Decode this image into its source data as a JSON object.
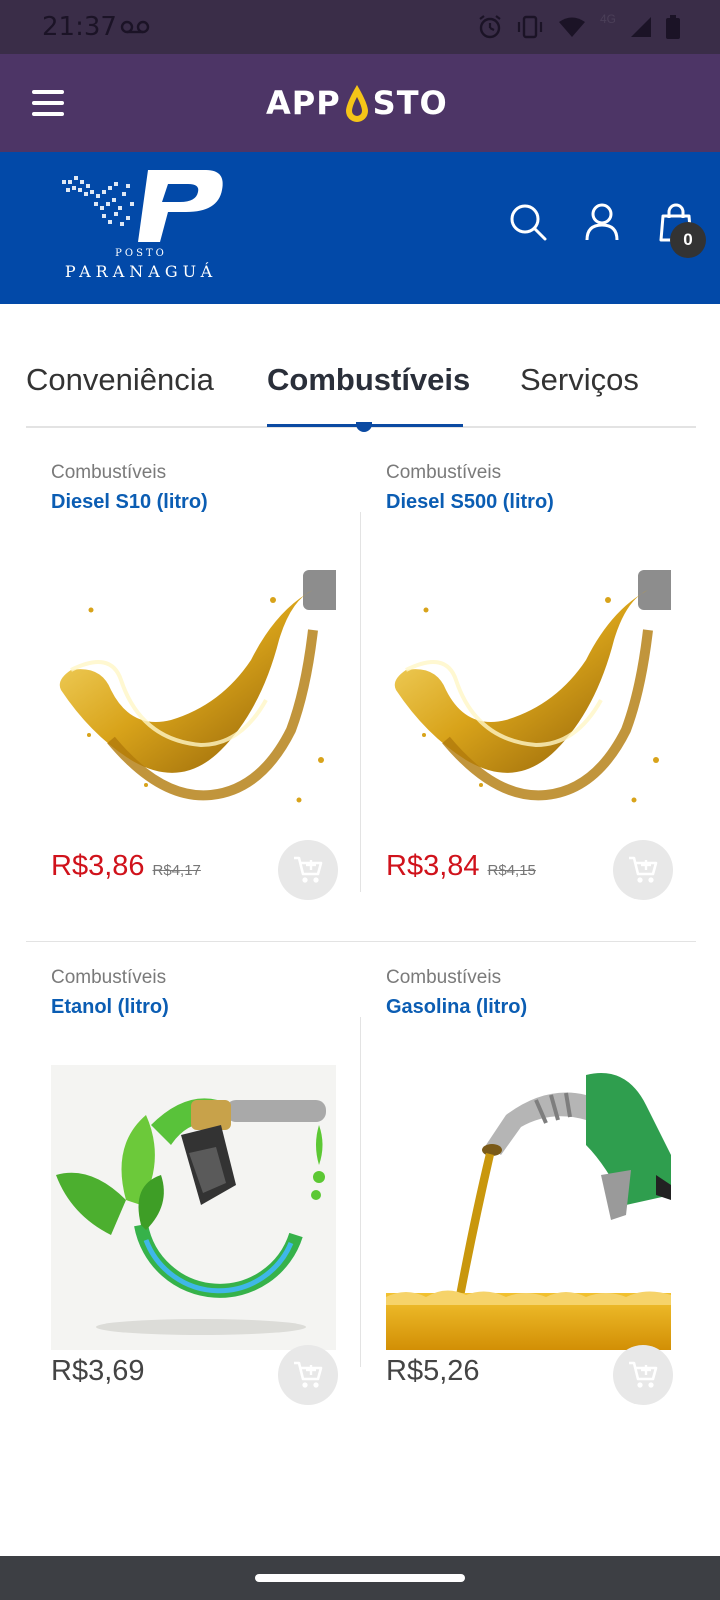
{
  "status_bar": {
    "time": "21:37",
    "network": "4G"
  },
  "app_bar": {
    "logo_left": "APP",
    "logo_right": "STO"
  },
  "store": {
    "logo_top": "POSTO",
    "logo_bottom": "PARANAGUÁ",
    "cart_count": "0"
  },
  "tabs": [
    {
      "label": "Conveniência",
      "active": false
    },
    {
      "label": "Combustíveis",
      "active": true
    },
    {
      "label": "Serviços",
      "active": false
    }
  ],
  "products": [
    {
      "category": "Combustíveis",
      "name": "Diesel S10 (litro)",
      "price": "R$3,86",
      "old_price": "R$4,17",
      "image": "diesel-oil-splash-image"
    },
    {
      "category": "Combustíveis",
      "name": "Diesel S500 (litro)",
      "price": "R$3,84",
      "old_price": "R$4,15",
      "image": "diesel-oil-splash-image"
    },
    {
      "category": "Combustíveis",
      "name": "Etanol (litro)",
      "price": "R$3,69",
      "old_price": "",
      "image": "ethanol-green-nozzle-image"
    },
    {
      "category": "Combustíveis",
      "name": "Gasolina (litro)",
      "price": "R$5,26",
      "old_price": "",
      "image": "gasoline-nozzle-pouring-image"
    }
  ],
  "colors": {
    "status_bar": "#3a2d48",
    "app_bar": "#4d3566",
    "store_header": "#0249a8",
    "product_name": "#0b5db3",
    "promo_price": "#d0121b",
    "tab_indicator": "#0b4aa2"
  }
}
